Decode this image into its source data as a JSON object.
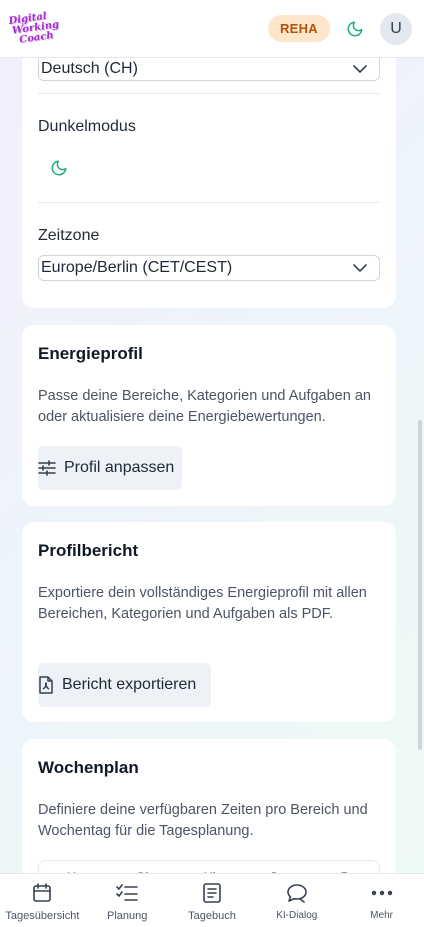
{
  "header": {
    "logo_lines": [
      "Digital",
      "Working",
      "Coach"
    ],
    "badge": "REHA",
    "avatar_initial": "U"
  },
  "settings": {
    "language_value": "Deutsch (CH)",
    "dark_mode_label": "Dunkelmodus",
    "timezone_label": "Zeitzone",
    "timezone_value": "Europe/Berlin (CET/CEST)"
  },
  "energy_profile": {
    "title": "Energieprofil",
    "description": "Passe deine Bereiche, Kategorien und Aufgaben an oder aktualisiere deine Energiebewertungen.",
    "button_label": "Profil anpassen"
  },
  "profile_report": {
    "title": "Profilbericht",
    "description": "Exportiere dein vollständiges Energieprofil mit allen Bereichen, Kategorien und Aufgaben als PDF.",
    "button_label": "Bericht exportieren"
  },
  "week_plan": {
    "title": "Wochenplan",
    "description": "Definiere deine verfügbaren Zeiten pro Bereich und Wochentag für die Tagesplanung.",
    "days": [
      "Mo",
      "Di",
      "Mi",
      "Do",
      "Fr"
    ]
  },
  "bottom_nav": [
    {
      "label": "Tagesübersicht",
      "icon": "calendar-icon"
    },
    {
      "label": "Planung",
      "icon": "checklist-icon"
    },
    {
      "label": "Tagebuch",
      "icon": "journal-icon"
    },
    {
      "label": "KI-Dialog",
      "icon": "chat-icon"
    },
    {
      "label": "Mehr",
      "icon": "more-icon"
    }
  ],
  "colors": {
    "accent_green": "#1fae7a",
    "badge_bg": "#fde6c9",
    "badge_text": "#b45309",
    "logo_purple": "#9b2fd0"
  }
}
